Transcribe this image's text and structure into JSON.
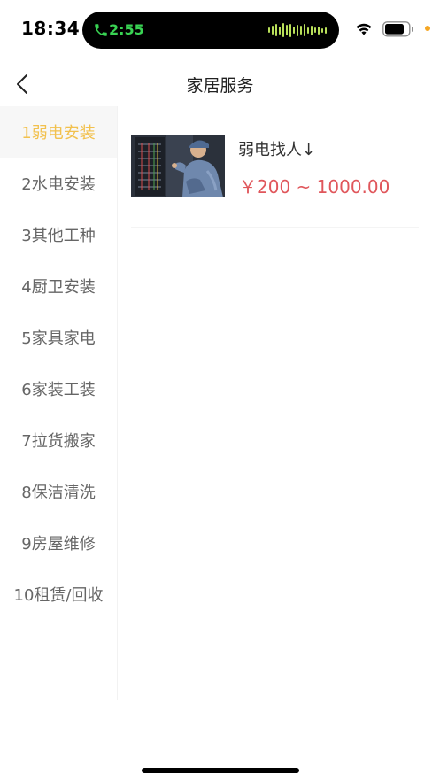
{
  "status_bar": {
    "time": "18:34",
    "call_time": "2:55",
    "call_color": "#39d353",
    "icons": [
      "phone-icon",
      "waveform-icon",
      "wifi-icon",
      "battery-icon"
    ]
  },
  "nav": {
    "title": "家居服务",
    "back_icon": "chevron-left-icon"
  },
  "sidebar": {
    "accent_color": "#f2c14e",
    "items": [
      {
        "label": "1弱电安装",
        "active": true
      },
      {
        "label": "2水电安装",
        "active": false
      },
      {
        "label": "3其他工种",
        "active": false
      },
      {
        "label": "4厨卫安装",
        "active": false
      },
      {
        "label": "5家具家电",
        "active": false
      },
      {
        "label": "6家装工装",
        "active": false
      },
      {
        "label": "7拉货搬家",
        "active": false
      },
      {
        "label": "8保洁清洗",
        "active": false
      },
      {
        "label": "9房屋维修",
        "active": false
      },
      {
        "label": "10租赁/回收",
        "active": false
      }
    ]
  },
  "products": [
    {
      "title": "弱电找人↓",
      "price": "￥200 ~ 1000.00",
      "price_color": "#e0565b",
      "image": "technician-server-rack-photo"
    }
  ]
}
